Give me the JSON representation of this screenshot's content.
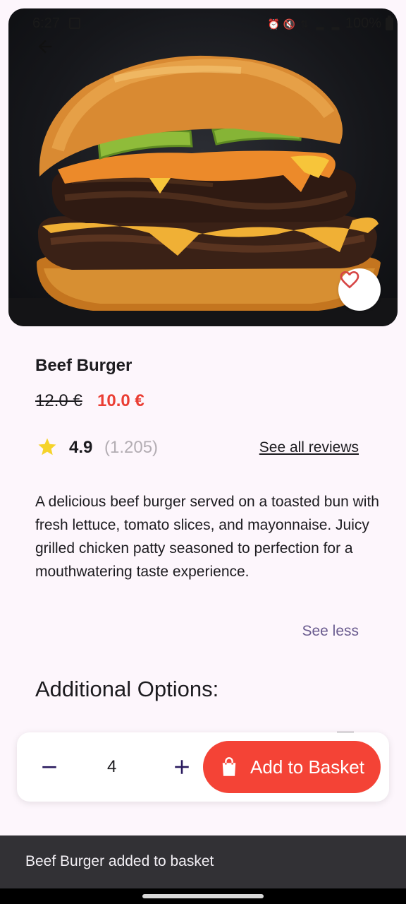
{
  "status_bar": {
    "time": "6:27",
    "battery": "100%"
  },
  "product": {
    "name": "Beef Burger",
    "price_old": "12.0 €",
    "price_new": "10.0 €",
    "rating": "4.9",
    "rating_count": "(1.205)",
    "see_all_reviews": "See all reviews",
    "description": "A delicious beef burger served on a toasted bun with fresh lettuce, tomato slices, and mayonnaise. Juicy grilled chicken patty seasoned to perfection for a mouthwatering taste experience.",
    "see_less": "See less"
  },
  "options": {
    "heading": "Additional Options:"
  },
  "order_bar": {
    "quantity": "4",
    "add_label": "Add to Basket"
  },
  "snackbar": {
    "message": "Beef Burger added to basket"
  },
  "colors": {
    "accent": "#f44336",
    "sale_price": "#ea3e34",
    "link_purple": "#6a5c8f",
    "background": "#fdf6fc",
    "star": "#f5d32a"
  },
  "icons": {
    "back": "arrow-left-icon",
    "favorite": "heart-outline-icon",
    "star": "star-icon",
    "minus": "minus-icon",
    "plus": "plus-icon",
    "basket": "shopping-bag-icon"
  }
}
